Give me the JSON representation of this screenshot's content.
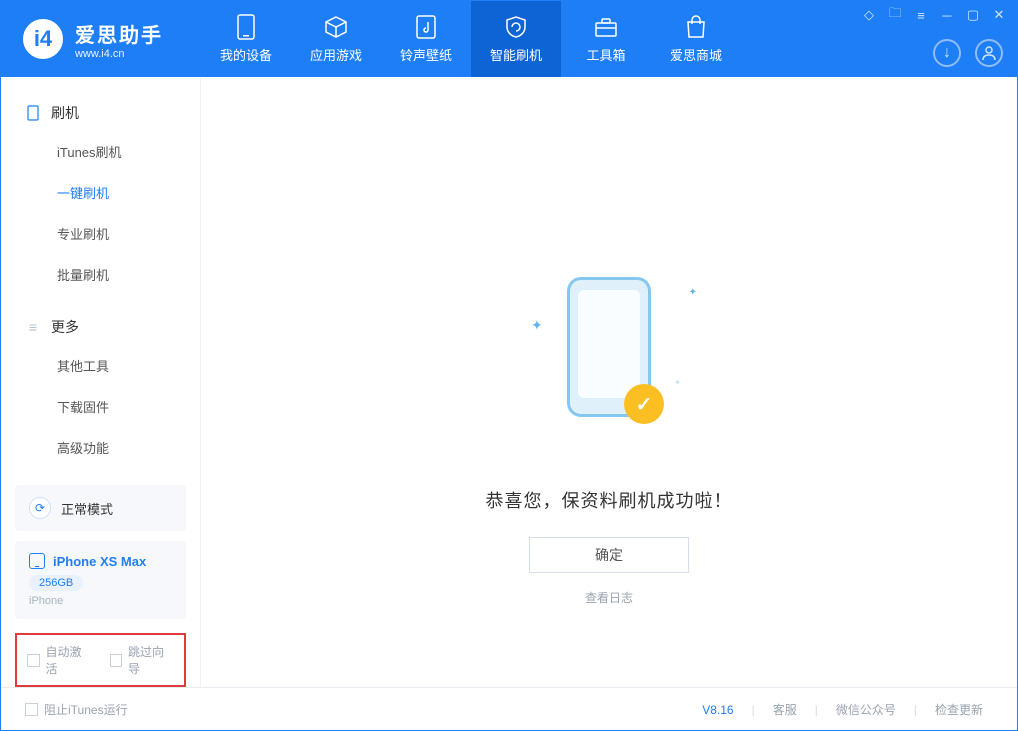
{
  "app": {
    "name": "爱思助手",
    "url": "www.i4.cn"
  },
  "nav": {
    "device": "我的设备",
    "apps": "应用游戏",
    "ringtones": "铃声壁纸",
    "flash": "智能刷机",
    "toolbox": "工具箱",
    "store": "爱思商城"
  },
  "sidebar": {
    "group_flash": "刷机",
    "items_flash": [
      "iTunes刷机",
      "一键刷机",
      "专业刷机",
      "批量刷机"
    ],
    "group_more": "更多",
    "items_more": [
      "其他工具",
      "下载固件",
      "高级功能"
    ]
  },
  "mode": {
    "label": "正常模式"
  },
  "device": {
    "name": "iPhone XS Max",
    "storage": "256GB",
    "type": "iPhone"
  },
  "options": {
    "auto_activate": "自动激活",
    "skip_guide": "跳过向导"
  },
  "main": {
    "success": "恭喜您，保资料刷机成功啦！",
    "ok": "确定",
    "view_log": "查看日志"
  },
  "footer": {
    "block_itunes": "阻止iTunes运行",
    "version": "V8.16",
    "support": "客服",
    "wechat": "微信公众号",
    "update": "检查更新"
  }
}
